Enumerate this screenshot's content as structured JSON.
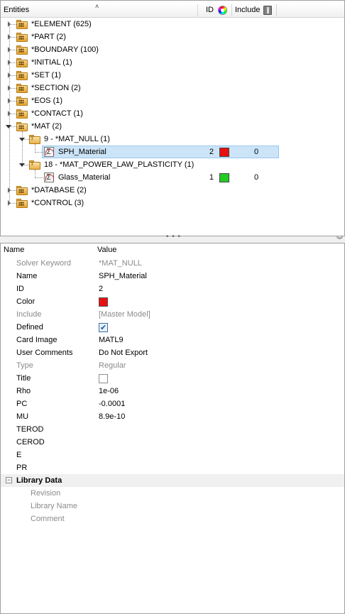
{
  "browser": {
    "header": {
      "entities_label": "Entities",
      "id_label": "ID",
      "color_icon": "color-wheel-icon",
      "include_label": "Include",
      "include_icon": "include-file-icon"
    },
    "tree": [
      {
        "label": "*ELEMENT  (625)",
        "state": "collapsed"
      },
      {
        "label": "*PART  (2)",
        "state": "collapsed"
      },
      {
        "label": "*BOUNDARY  (100)",
        "state": "collapsed"
      },
      {
        "label": "*INITIAL  (1)",
        "state": "collapsed"
      },
      {
        "label": "*SET  (1)",
        "state": "collapsed"
      },
      {
        "label": "*SECTION  (2)",
        "state": "collapsed"
      },
      {
        "label": "*EOS  (1)",
        "state": "collapsed"
      },
      {
        "label": "*CONTACT  (1)",
        "state": "collapsed"
      },
      {
        "label": "*MAT  (2)",
        "state": "expanded"
      },
      {
        "label": "9 - *MAT_NULL  (1)",
        "state": "expanded"
      },
      {
        "label": "SPH_Material",
        "id": "2",
        "color": "#e81010",
        "include": "0",
        "selected": true
      },
      {
        "label": "18 - *MAT_POWER_LAW_PLASTICITY  (1)",
        "state": "expanded"
      },
      {
        "label": "Glass_Material",
        "id": "1",
        "color": "#22cc22",
        "include": "0"
      },
      {
        "label": "*DATABASE  (2)",
        "state": "collapsed"
      },
      {
        "label": "*CONTROL  (3)",
        "state": "collapsed"
      }
    ]
  },
  "splitter": {
    "grip": "• • •",
    "chevron": "»"
  },
  "props": {
    "header": {
      "name": "Name",
      "value": "Value"
    },
    "rows": {
      "solver_keyword": {
        "name": "Solver Keyword",
        "value": "*MAT_NULL"
      },
      "name": {
        "name": "Name",
        "value": "SPH_Material"
      },
      "id": {
        "name": "ID",
        "value": "2"
      },
      "color": {
        "name": "Color",
        "value": "#e81010"
      },
      "include": {
        "name": "Include",
        "value": "[Master Model]"
      },
      "defined": {
        "name": "Defined",
        "checked": true
      },
      "card_image": {
        "name": "Card Image",
        "value": "MATL9"
      },
      "user_comments": {
        "name": "User Comments",
        "value": "Do Not Export"
      },
      "type": {
        "name": "Type",
        "value": "Regular"
      },
      "title": {
        "name": "Title",
        "checked": false
      },
      "rho": {
        "name": "Rho",
        "value": "1e-06"
      },
      "pc": {
        "name": "PC",
        "value": "-0.0001"
      },
      "mu": {
        "name": "MU",
        "value": "8.9e-10"
      },
      "terod": {
        "name": "TEROD",
        "value": ""
      },
      "cerod": {
        "name": "CEROD",
        "value": ""
      },
      "e": {
        "name": "E",
        "value": ""
      },
      "pr": {
        "name": "PR",
        "value": ""
      }
    },
    "library": {
      "title": "Library Data",
      "toggle": "−",
      "rows": [
        "Revision",
        "Library Name",
        "Comment"
      ]
    }
  }
}
